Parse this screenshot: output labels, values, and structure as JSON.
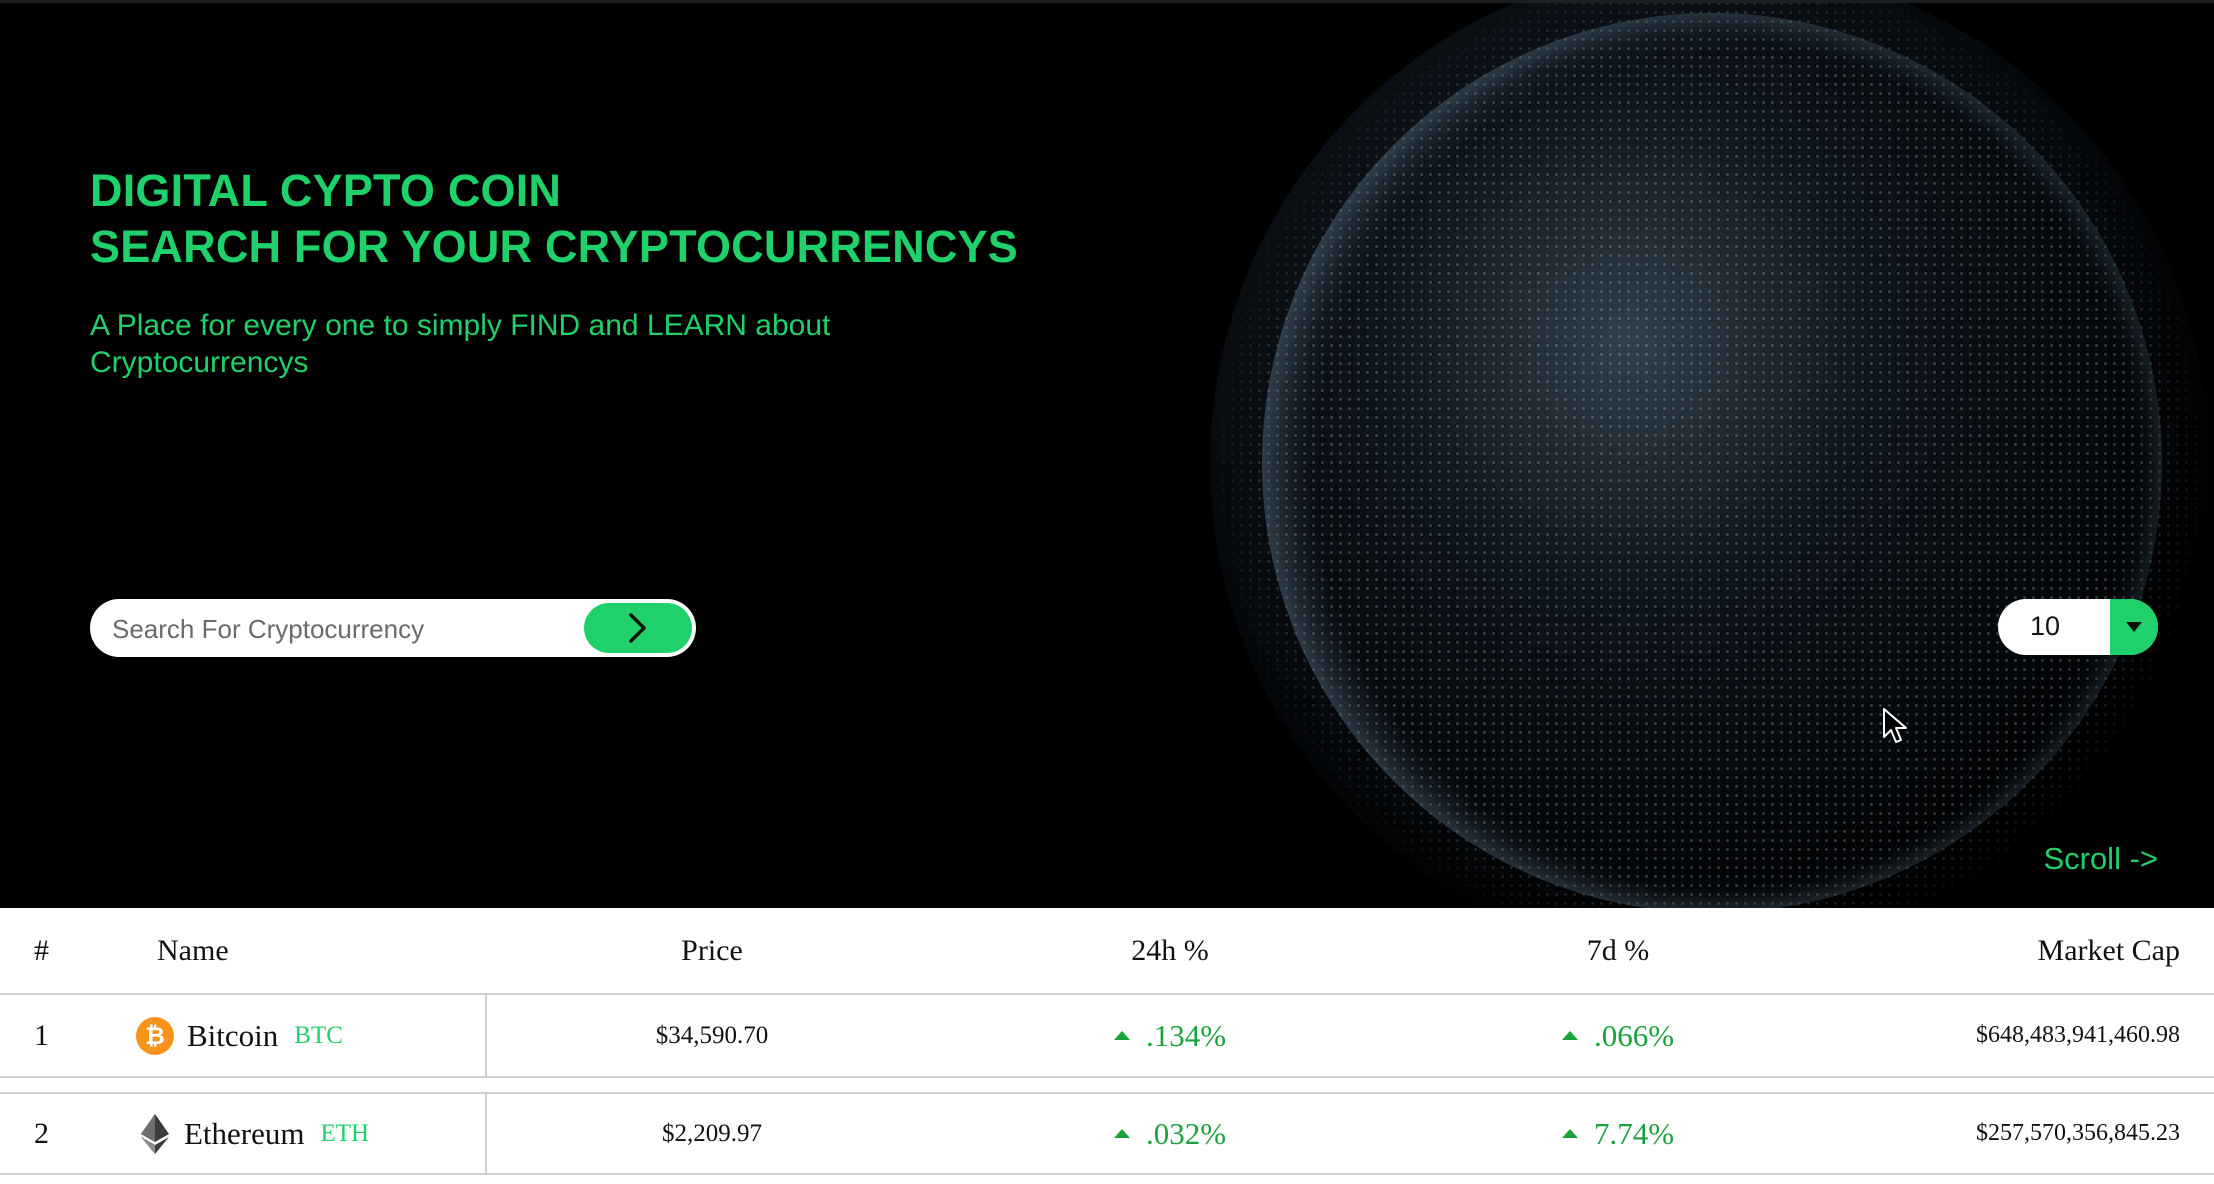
{
  "hero": {
    "headline_line1": "DIGITAL CYPTO COIN",
    "headline_line2": "SEARCH FOR YOUR CRYPTOCURRENCYS",
    "subtitle": "A Place for every one to simply FIND and LEARN about Cryptocurrencys",
    "search": {
      "placeholder": "Search For Cryptocurrency",
      "value": "",
      "button_icon": "chevron-right-icon"
    },
    "per_page_select": {
      "value": "10",
      "icon": "caret-down-icon"
    },
    "scroll_link": "Scroll ->"
  },
  "colors": {
    "accent": "#1fd16a",
    "positive": "#1aa33b",
    "hero_bg": "#000000"
  },
  "table": {
    "headers": {
      "rank": "#",
      "name": "Name",
      "price": "Price",
      "change_24h": "24h %",
      "change_7d": "7d %",
      "market_cap": "Market Cap"
    },
    "rows": [
      {
        "rank": "1",
        "icon": "bitcoin-icon",
        "name": "Bitcoin",
        "symbol": "BTC",
        "price": "$34,590.70",
        "change_24h": ".134%",
        "change_7d": ".066%",
        "market_cap": "$648,483,941,460.98"
      },
      {
        "rank": "2",
        "icon": "ethereum-icon",
        "name": "Ethereum",
        "symbol": "ETH",
        "price": "$2,209.97",
        "change_24h": ".032%",
        "change_7d": "7.74%",
        "market_cap": "$257,570,356,845.23"
      }
    ]
  }
}
